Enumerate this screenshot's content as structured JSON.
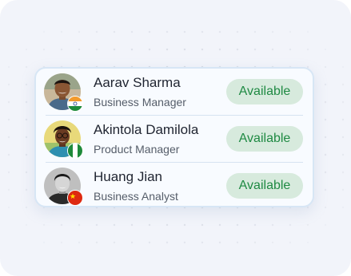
{
  "team": {
    "members": [
      {
        "name": "Aarav Sharma",
        "role": "Business Manager",
        "status": "Available",
        "flag_icon": "india-flag-icon"
      },
      {
        "name": "Akintola Damilola",
        "role": "Product Manager",
        "status": "Available",
        "flag_icon": "nigeria-flag-icon"
      },
      {
        "name": "Huang Jian",
        "role": "Business Analyst",
        "status": "Available",
        "flag_icon": "china-flag-icon"
      }
    ]
  },
  "colors": {
    "status_text": "#1f8a43",
    "status_bg": "#d7eadd",
    "card_border": "#d7e6f5",
    "background": "#f2f4fa"
  }
}
